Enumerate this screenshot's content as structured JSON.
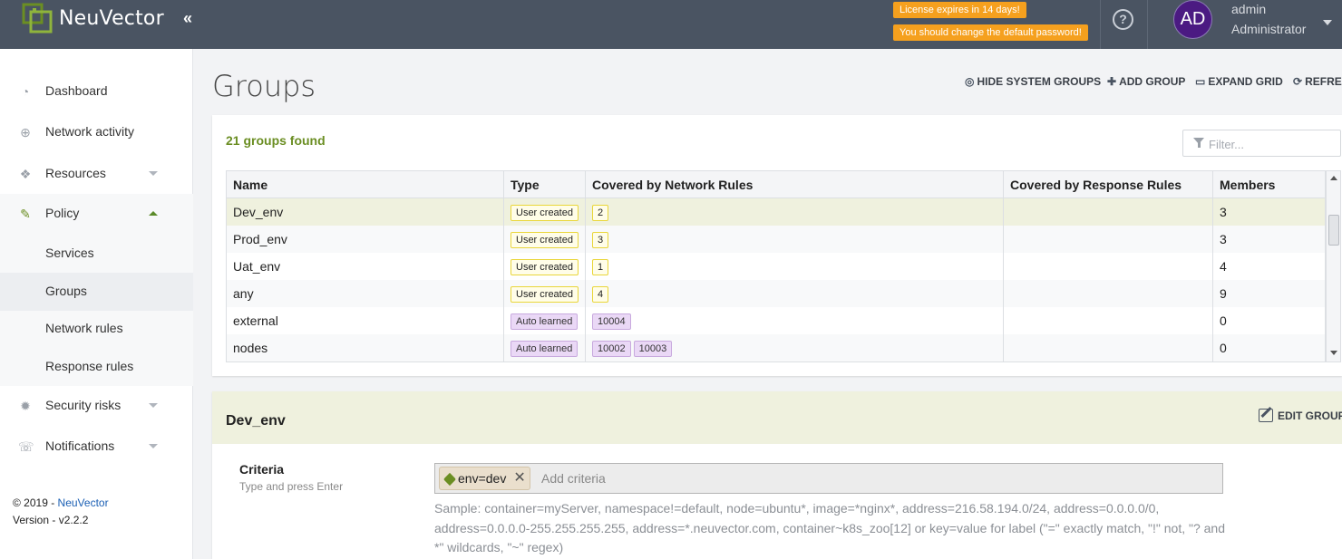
{
  "app": {
    "brand": "NeuVector",
    "collapse_glyph": "«"
  },
  "alerts": [
    "License expires in 14 days!",
    "You should change the default password!"
  ],
  "user": {
    "initials": "AD",
    "name": "admin",
    "role": "Administrator"
  },
  "icons": {
    "help": "?",
    "dashboard": "◔",
    "network": "⊕",
    "resources": "❖",
    "policy": "✎",
    "security": "✹",
    "notifications": "☏"
  },
  "sidebar": {
    "items": [
      {
        "label": "Dashboard"
      },
      {
        "label": "Network activity"
      },
      {
        "label": "Resources"
      },
      {
        "label": "Policy"
      },
      {
        "label": "Security risks"
      },
      {
        "label": "Notifications"
      }
    ],
    "policy_sub": [
      {
        "label": "Services"
      },
      {
        "label": "Groups"
      },
      {
        "label": "Network rules"
      },
      {
        "label": "Response rules"
      }
    ],
    "footer": {
      "copyright": "© 2019 - ",
      "link": "NeuVector",
      "version": "Version - v2.2.2"
    }
  },
  "main": {
    "title": "Groups",
    "toolbar": {
      "hide_system": "HIDE SYSTEM GROUPS",
      "add_group": "ADD GROUP",
      "expand_grid": "EXPAND GRID",
      "refresh": "REFRESH",
      "hide_icon": "◎",
      "add_icon": "✚",
      "expand_icon": "▭",
      "refresh_icon": "⟳"
    },
    "found_text": "21 groups found",
    "filter_placeholder": "Filter...",
    "columns": [
      "Name",
      "Type",
      "Covered by Network Rules",
      "Covered by Response Rules",
      "Members"
    ],
    "rows": [
      {
        "name": "Dev_env",
        "type": "User created",
        "network": [
          "2"
        ],
        "response": "",
        "members": "3"
      },
      {
        "name": "Prod_env",
        "type": "User created",
        "network": [
          "3"
        ],
        "response": "",
        "members": "3"
      },
      {
        "name": "Uat_env",
        "type": "User created",
        "network": [
          "1"
        ],
        "response": "",
        "members": "4"
      },
      {
        "name": "any",
        "type": "User created",
        "network": [
          "4"
        ],
        "response": "",
        "members": "9"
      },
      {
        "name": "external",
        "type": "Auto learned",
        "network": [
          "10004"
        ],
        "response": "",
        "members": "0"
      },
      {
        "name": "nodes",
        "type": "Auto learned",
        "network": [
          "10002",
          "10003"
        ],
        "response": "",
        "members": "0"
      }
    ],
    "detail": {
      "title": "Dev_env",
      "edit_label": "EDIT GROUP",
      "criteria_label": "Criteria",
      "criteria_hint": "Type and press Enter",
      "chip": "env=dev",
      "chip_remove": "✕",
      "criteria_placeholder": "Add criteria",
      "sample": "Sample: container=myServer, namespace!=default, node=ubuntu*, image=*nginx*, address=216.58.194.0/24, address=0.0.0.0/0, address=0.0.0.0-255.255.255.255, address=*.neuvector.com, container~k8s_zoo[12] or key=value for label (\"=\" exactly match, \"!\" not, \"? and *\" wildcards, \"~\" regex)"
    }
  },
  "colors": {
    "topbar": "#4a5462",
    "accent": "#6b8e23",
    "alert": "#f5a01e",
    "avatar": "#4b1a82",
    "selected_row": "#eff1de"
  }
}
